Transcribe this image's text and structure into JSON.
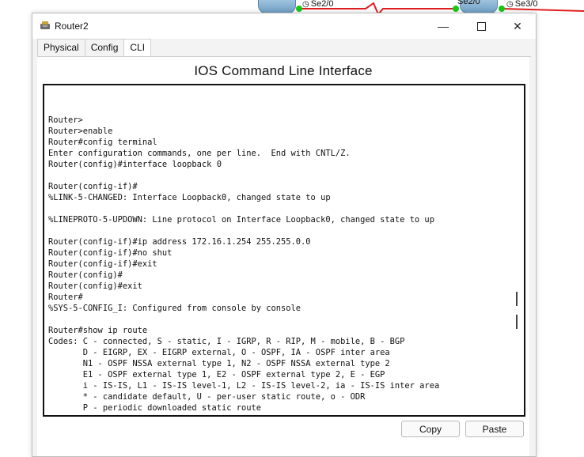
{
  "background": {
    "ports": [
      {
        "label": "Se2/0"
      },
      {
        "label": "Se2/0"
      },
      {
        "label": "Se3/0"
      }
    ],
    "clock_icon": "clock-icon",
    "link_color": "#e01f1f",
    "port_status_color": "#19c819"
  },
  "window": {
    "title": "Router2",
    "app_icon": "router-device-icon",
    "controls": {
      "minimize": "—",
      "close": "✕"
    }
  },
  "tabs": [
    {
      "label": "Physical",
      "active": false
    },
    {
      "label": "Config",
      "active": false
    },
    {
      "label": "CLI",
      "active": true
    }
  ],
  "cli": {
    "heading": "IOS Command Line Interface",
    "lines": [
      "",
      "Router>",
      "Router>enable",
      "Router#config terminal",
      "Enter configuration commands, one per line.  End with CNTL/Z.",
      "Router(config)#interface loopback 0",
      "",
      "Router(config-if)#",
      "%LINK-5-CHANGED: Interface Loopback0, changed state to up",
      "",
      "%LINEPROTO-5-UPDOWN: Line protocol on Interface Loopback0, changed state to up",
      "",
      "Router(config-if)#ip address 172.16.1.254 255.255.0.0",
      "Router(config-if)#no shut",
      "Router(config-if)#exit",
      "Router(config)#",
      "Router(config)#exit",
      "Router#",
      "%SYS-5-CONFIG_I: Configured from console by console",
      "",
      "Router#show ip route",
      "Codes: C - connected, S - static, I - IGRP, R - RIP, M - mobile, B - BGP",
      "       D - EIGRP, EX - EIGRP external, O - OSPF, IA - OSPF inter area",
      "       N1 - OSPF NSSA external type 1, N2 - OSPF NSSA external type 2",
      "       E1 - OSPF external type 1, E2 - OSPF external type 2, E - EGP",
      "       i - IS-IS, L1 - IS-IS level-1, L2 - IS-IS level-2, ia - IS-IS inter area",
      "       * - candidate default, U - per-user static route, o - ODR",
      "       P - periodic downloaded static route"
    ]
  },
  "buttons": {
    "copy": "Copy",
    "paste": "Paste"
  }
}
